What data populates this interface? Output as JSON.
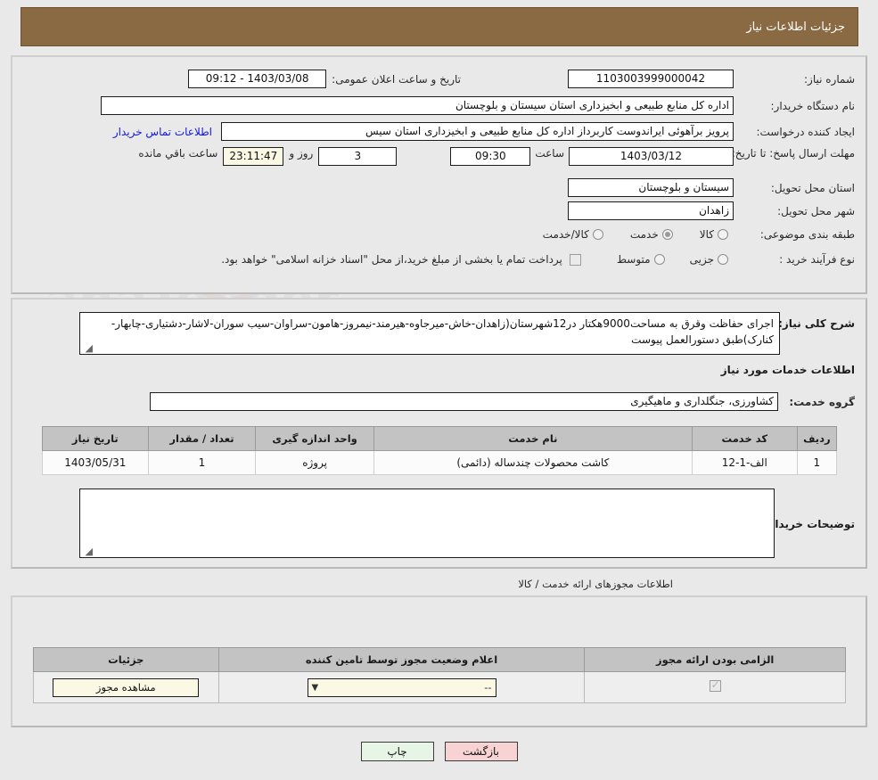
{
  "header": {
    "title": "جزئیات اطلاعات نیاز"
  },
  "main": {
    "need_number_label": "شماره نیاز:",
    "need_number_value": "1103003999000042",
    "announce_label": "تاریخ و ساعت اعلان عمومی:",
    "announce_value": "1403/03/08 - 09:12",
    "buyer_org_label": "نام دستگاه خریدار:",
    "buyer_org_value": "اداره کل منابع طبیعی و ابخیزداری استان سیستان و بلوچستان",
    "requester_label": "ایجاد کننده درخواست:",
    "requester_value": "پرویز برآهوئی ایراندوست کاربرداز اداره کل منابع طبیعی و ابخیزداری استان سیس",
    "buyer_contact_link": "اطلاعات تماس خریدار",
    "deadline_label": "مهلت ارسال پاسخ: تا تاریخ:",
    "deadline_date": "1403/03/12",
    "deadline_hour_label": "ساعت",
    "deadline_hour": "09:30",
    "days_remaining": "3",
    "days_label": "روز و",
    "time_remaining": "23:11:47",
    "time_remaining_label": "ساعت باقي مانده",
    "province_label": "استان محل تحویل:",
    "province_value": "سیستان و بلوچستان",
    "city_label": "شهر محل تحویل:",
    "city_value": "زاهدان",
    "category_label": "طبقه بندی موضوعی:",
    "category_options": [
      {
        "label": "کالا",
        "selected": false
      },
      {
        "label": "خدمت",
        "selected": true
      },
      {
        "label": "کالا/خدمت",
        "selected": false
      }
    ],
    "process_label": "نوع فرآیند خرید :",
    "process_options": [
      {
        "label": "جزیی",
        "selected": false
      },
      {
        "label": "متوسط",
        "selected": false
      }
    ],
    "treasury_checkbox_checked": false,
    "treasury_note": "پرداخت تمام یا بخشی از مبلغ خرید،از محل \"اسناد خزانه اسلامی\" خواهد بود."
  },
  "description": {
    "overall_label": "شرح کلی نیاز:",
    "overall_value": "اجرای حفاظت وقرق به مساحت9000هکتار در12شهرستان(زاهدان-خاش-میرجاوه-هیرمند-نیمروز-هامون-سراوان-سیب سوران-لاشار-دشتیاری-چابهار-کنارک)طبق دستورالعمل پیوست",
    "services_info_title": "اطلاعات خدمات مورد نیاز",
    "service_group_label": "گروه خدمت:",
    "service_group_value": "کشاورزی، جنگلداری و ماهیگیری",
    "buyer_notes_label": "توضیحات خریدار:",
    "buyer_notes_value": ""
  },
  "service_table": {
    "columns": [
      "ردیف",
      "کد خدمت",
      "نام خدمت",
      "واحد اندازه گیری",
      "تعداد / مقدار",
      "تاریخ نیاز"
    ],
    "rows": [
      {
        "row_no": "1",
        "code": "الف-1-12",
        "name": "کاشت محصولات چندساله (دائمی)",
        "unit": "پروژه",
        "quantity": "1",
        "need_date": "1403/05/31"
      }
    ]
  },
  "permits": {
    "section_title": "اطلاعات مجوزهای ارائه خدمت / کالا",
    "columns": [
      "الزامی بودن ارائه مجوز",
      "اعلام وضعیت مجوز توسط تامین کننده",
      "جزئیات"
    ],
    "rows": [
      {
        "required_checked": true,
        "status_value": "--",
        "details_button": "مشاهده مجوز"
      }
    ]
  },
  "footer": {
    "print_label": "چاپ",
    "back_label": "بازگشت"
  },
  "colors": {
    "header_bg": "#8a6a42",
    "link": "#1417d8",
    "print_btn": "#e6f5e6",
    "back_btn": "#f8d3d3",
    "highlight_field": "#fbf8e3"
  },
  "watermark": {
    "text": "AnaTender.net"
  }
}
